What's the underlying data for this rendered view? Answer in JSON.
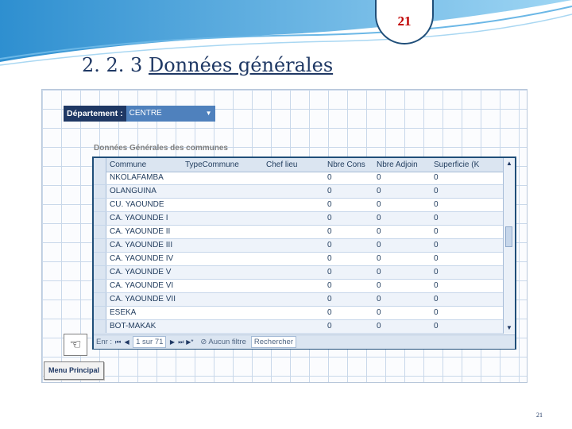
{
  "slide": {
    "number_badge": "21",
    "title_prefix": "2. 2. 3",
    "title_main": "Données générales",
    "page_number": "21"
  },
  "form": {
    "department_label": "Département :",
    "department_value": "CENTRE",
    "subform_title": "Données Générales des communes",
    "columns": [
      "Commune",
      "TypeCommune",
      "Chef lieu",
      "Nbre Cons",
      "Nbre Adjoin",
      "Superficie (K"
    ],
    "rows": [
      [
        "NKOLAFAMBA",
        "",
        "",
        "0",
        "0",
        "0"
      ],
      [
        "OLANGUINA",
        "",
        "",
        "0",
        "0",
        "0"
      ],
      [
        "CU. YAOUNDE",
        "",
        "",
        "0",
        "0",
        "0"
      ],
      [
        "CA. YAOUNDE I",
        "",
        "",
        "0",
        "0",
        "0"
      ],
      [
        "CA. YAOUNDE II",
        "",
        "",
        "0",
        "0",
        "0"
      ],
      [
        "CA. YAOUNDE III",
        "",
        "",
        "0",
        "0",
        "0"
      ],
      [
        "CA. YAOUNDE IV",
        "",
        "",
        "0",
        "0",
        "0"
      ],
      [
        "CA. YAOUNDE V",
        "",
        "",
        "0",
        "0",
        "0"
      ],
      [
        "CA. YAOUNDE VI",
        "",
        "",
        "0",
        "0",
        "0"
      ],
      [
        "CA. YAOUNDE VII",
        "",
        "",
        "0",
        "0",
        "0"
      ],
      [
        "ESEKA",
        "",
        "",
        "0",
        "0",
        "0"
      ],
      [
        "BOT-MAKAK",
        "",
        "",
        "0",
        "0",
        "0"
      ]
    ],
    "nav": {
      "record_label": "Enr :",
      "record_value": "1 sur 71",
      "filter_label": "Aucun filtre",
      "search_label": "Rechercher"
    },
    "menu_button": "Menu Principal"
  },
  "colors": {
    "accent": "#1f3864",
    "badge_number": "#c00000",
    "header_bg": "#dbe5f1"
  }
}
